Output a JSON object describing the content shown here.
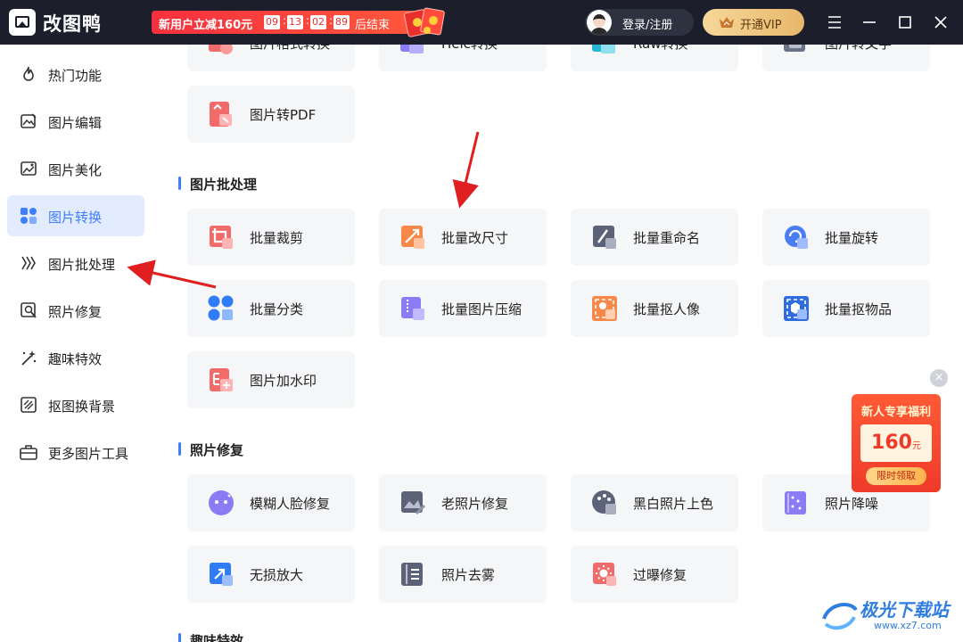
{
  "app": {
    "name": "改图鸭"
  },
  "promo": {
    "text": "新用户立减160元",
    "timer": [
      "09",
      "13",
      "02",
      "89"
    ],
    "end": "后结束"
  },
  "header": {
    "login": "登录/注册",
    "vip": "开通VIP"
  },
  "sidebar": {
    "items": [
      {
        "label": "热门功能",
        "icon": "flame-icon"
      },
      {
        "label": "图片编辑",
        "icon": "image-edit-icon"
      },
      {
        "label": "图片美化",
        "icon": "image-beauty-icon"
      },
      {
        "label": "图片转换",
        "icon": "convert-icon",
        "active": true
      },
      {
        "label": "图片批处理",
        "icon": "batch-icon"
      },
      {
        "label": "照片修复",
        "icon": "repair-icon"
      },
      {
        "label": "趣味特效",
        "icon": "magic-icon"
      },
      {
        "label": "抠图换背景",
        "icon": "cutout-icon"
      },
      {
        "label": "更多图片工具",
        "icon": "toolbox-icon"
      }
    ]
  },
  "top_row": [
    {
      "label": "图片格式转换"
    },
    {
      "label": "Heic转换"
    },
    {
      "label": "Raw转换"
    },
    {
      "label": "图片转文字"
    }
  ],
  "convert_extra": {
    "label": "图片转PDF"
  },
  "sections": {
    "batch": {
      "title": "图片批处理",
      "items": [
        {
          "label": "批量裁剪"
        },
        {
          "label": "批量改尺寸"
        },
        {
          "label": "批量重命名"
        },
        {
          "label": "批量旋转"
        },
        {
          "label": "批量分类"
        },
        {
          "label": "批量图片压缩"
        },
        {
          "label": "批量抠人像"
        },
        {
          "label": "批量抠物品"
        },
        {
          "label": "图片加水印"
        }
      ]
    },
    "repair": {
      "title": "照片修复",
      "items": [
        {
          "label": "模糊人脸修复"
        },
        {
          "label": "老照片修复"
        },
        {
          "label": "黑白照片上色"
        },
        {
          "label": "照片降噪"
        },
        {
          "label": "无损放大"
        },
        {
          "label": "照片去雾"
        },
        {
          "label": "过曝修复"
        }
      ]
    },
    "fun": {
      "title": "趣味特效"
    }
  },
  "floater": {
    "title": "新人专享福利",
    "amount": "160",
    "unit": "元",
    "button": "限时领取"
  },
  "watermark": {
    "name": "极光下载站",
    "url": "www.xz7.com"
  },
  "colors": {
    "accent": "#3d7dff",
    "titlebar": "#1c1f2b",
    "promo": "#f5303e",
    "annotation_arrow": "#e02020"
  }
}
